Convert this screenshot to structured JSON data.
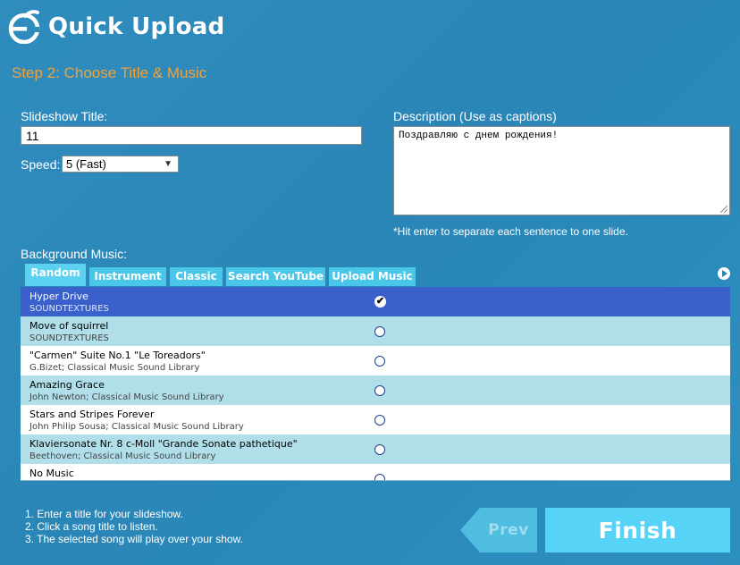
{
  "header": {
    "logo_text": "Quick Upload"
  },
  "step": {
    "title": "Step 2: Choose Title & Music"
  },
  "form": {
    "slideshow_title_label": "Slideshow Title:",
    "slideshow_title_value": "11",
    "speed_label": "Speed:",
    "speed_value": "5 (Fast)",
    "description_label": "Description (Use as captions)",
    "description_value": "Поздравляю с днем рождения!",
    "description_hint": "*Hit enter to separate each sentence to one slide."
  },
  "music": {
    "label": "Background Music:",
    "tabs": [
      {
        "label": "Random",
        "active": true
      },
      {
        "label": "Instrument"
      },
      {
        "label": "Classic"
      },
      {
        "label": "Search YouTube"
      },
      {
        "label": "Upload Music"
      }
    ],
    "songs": [
      {
        "title": "Hyper Drive",
        "artist": "SOUNDTEXTURES",
        "selected": true
      },
      {
        "title": "Move of squirrel",
        "artist": "SOUNDTEXTURES"
      },
      {
        "title": "\"Carmen\" Suite No.1 \"Le Toreadors\"",
        "artist": "G.Bizet; Classical Music Sound Library"
      },
      {
        "title": "Amazing Grace",
        "artist": "John Newton; Classical Music Sound Library"
      },
      {
        "title": "Stars and Stripes Forever",
        "artist": "John Philip Sousa; Classical Music Sound Library"
      },
      {
        "title": "Klaviersonate Nr. 8 c-Moll \"Grande Sonate pathetique\"",
        "artist": "Beethoven; Classical Music Sound Library"
      },
      {
        "title": "No Music",
        "artist": ""
      }
    ]
  },
  "instructions": {
    "line1": "1. Enter a title for your slideshow.",
    "line2": "2. Click a song title to listen.",
    "line3": "3. The selected song will play over your show."
  },
  "buttons": {
    "prev": "Prev",
    "finish": "Finish"
  },
  "colors": {
    "accent": "#f0a23c",
    "selected_row": "#3a60cc",
    "tab": "#49c6e8",
    "finish": "#56d3f7"
  }
}
